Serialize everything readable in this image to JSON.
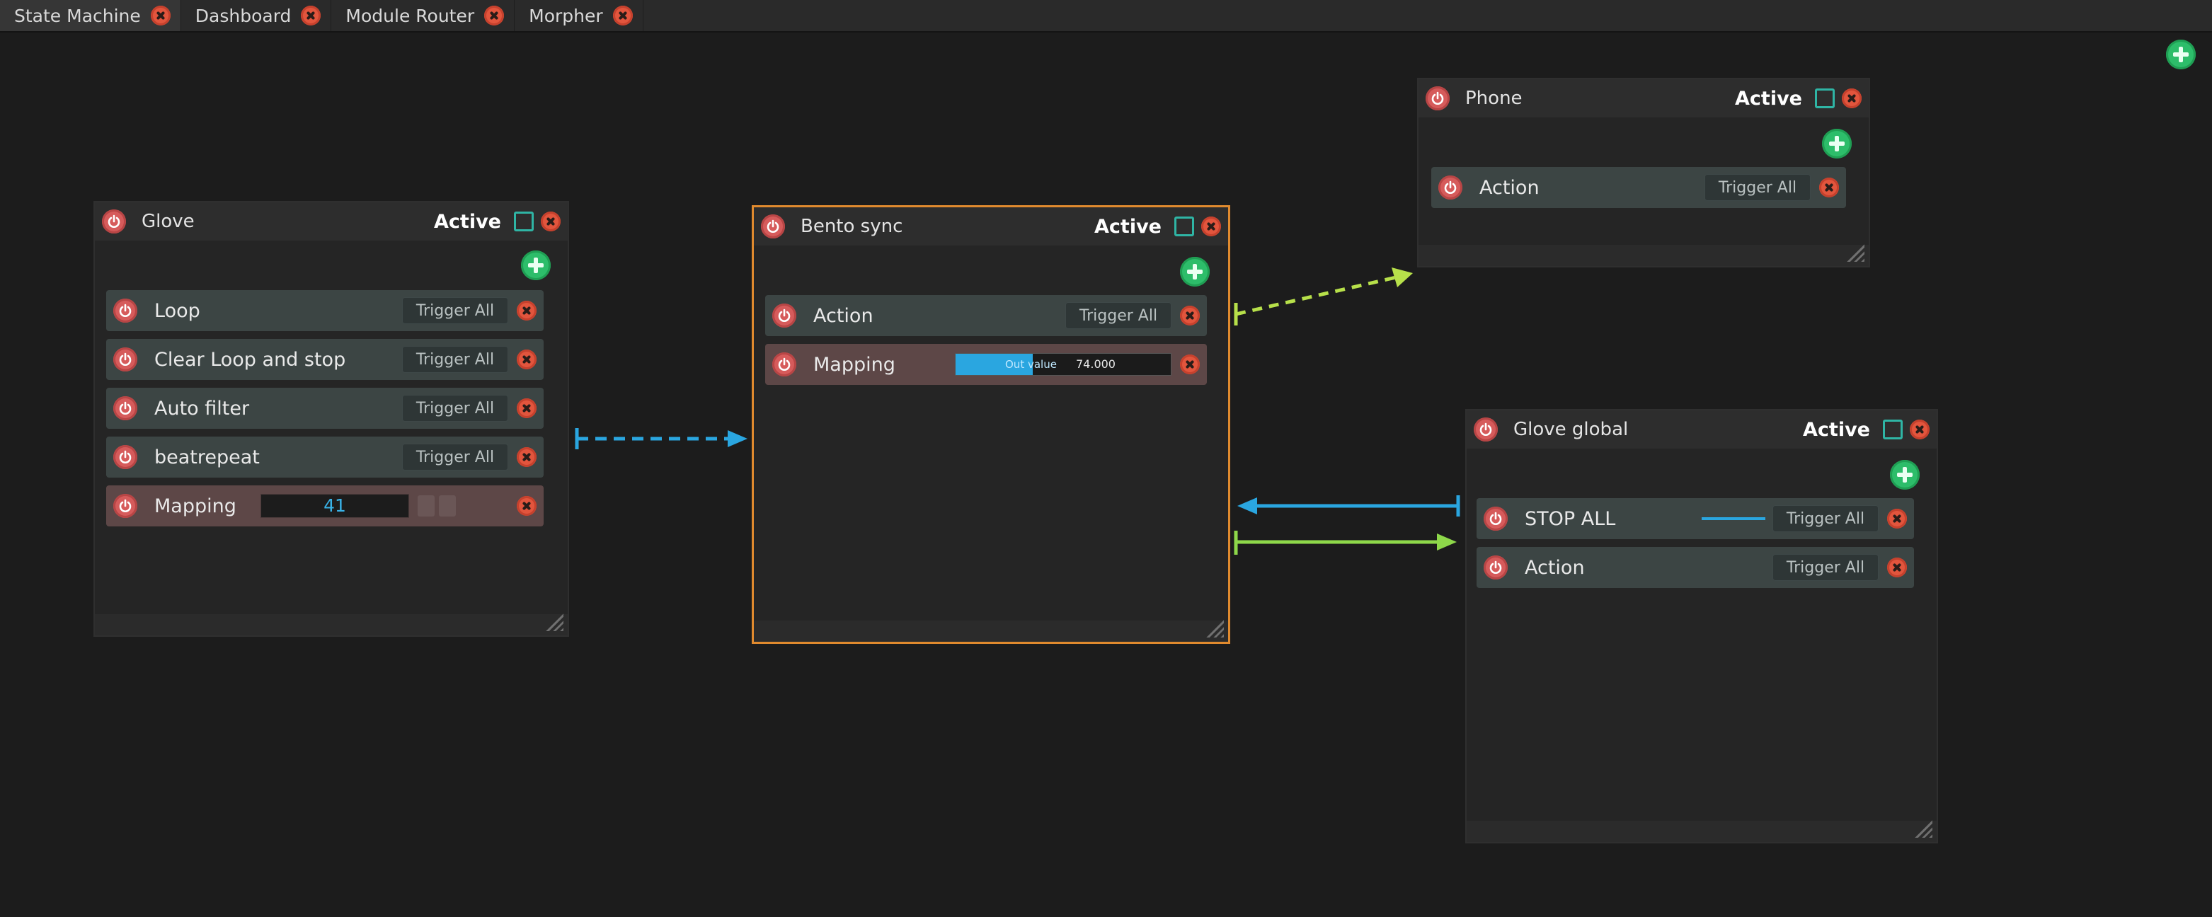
{
  "tabs": [
    {
      "label": "State Machine"
    },
    {
      "label": "Dashboard"
    },
    {
      "label": "Module Router"
    },
    {
      "label": "Morpher"
    }
  ],
  "nodes": {
    "glove": {
      "title": "Glove",
      "active_label": "Active",
      "rows": [
        {
          "label": "Loop",
          "trigger": "Trigger All"
        },
        {
          "label": "Clear Loop and stop",
          "trigger": "Trigger All"
        },
        {
          "label": "Auto filter",
          "trigger": "Trigger All"
        },
        {
          "label": "beatrepeat",
          "trigger": "Trigger All"
        },
        {
          "label": "Mapping",
          "value": "41"
        }
      ]
    },
    "bento": {
      "title": "Bento sync",
      "active_label": "Active",
      "rows": [
        {
          "label": "Action",
          "trigger": "Trigger All"
        },
        {
          "label": "Mapping",
          "out_label": "Out value",
          "out_value": "74.000",
          "out_fraction": 0.36
        }
      ]
    },
    "phone": {
      "title": "Phone",
      "active_label": "Active",
      "rows": [
        {
          "label": "Action",
          "trigger": "Trigger All"
        }
      ]
    },
    "glove_global": {
      "title": "Glove global",
      "active_label": "Active",
      "rows": [
        {
          "label": "STOP ALL",
          "trigger": "Trigger All"
        },
        {
          "label": "Action",
          "trigger": "Trigger All"
        }
      ]
    }
  },
  "colors": {
    "link_blue": "#2aa6e0",
    "link_green": "#8ed84a",
    "link_lime": "#b7e04a",
    "selection": "#e08a2e"
  }
}
